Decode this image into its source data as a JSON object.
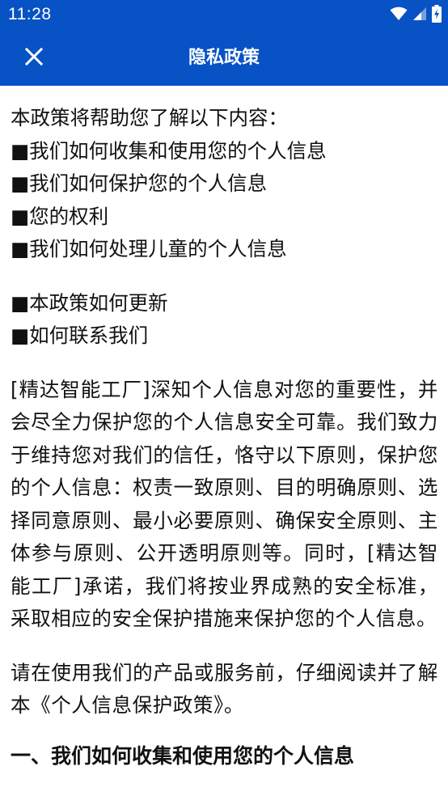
{
  "status_bar": {
    "time": "11:28",
    "icons": [
      "wifi-icon",
      "cell-signal-icon",
      "battery-charging-icon"
    ]
  },
  "app_bar": {
    "title": "隐私政策",
    "close_icon": "close-icon"
  },
  "colors": {
    "primary": "#0752c4",
    "text": "#111111",
    "background": "#ffffff"
  },
  "content": {
    "intro": "本政策将帮助您了解以下内容：",
    "toc_items": [
      "■我们如何收集和使用您的个人信息",
      "■我们如何保护您的个人信息",
      "■您的权利",
      "■我们如何处理儿童的个人信息"
    ],
    "toc_items_2": [
      "■本政策如何更新",
      "■如何联系我们"
    ],
    "paragraph_1": "[精达智能工厂]深知个人信息对您的重要性，并会尽全力保护您的个人信息安全可靠。我们致力于维持您对我们的信任，恪守以下原则，保护您的个人信息：权责一致原则、目的明确原则、选择同意原则、最小必要原则、确保安全原则、主体参与原则、公开透明原则等。同时，[精达智能工厂]承诺，我们将按业界成熟的安全标准，采取相应的安全保护措施来保护您的个人信息。",
    "paragraph_2": "请在使用我们的产品或服务前，仔细阅读并了解本《个人信息保护政策》。",
    "section_1_heading": "一、我们如何收集和使用您的个人信息"
  }
}
